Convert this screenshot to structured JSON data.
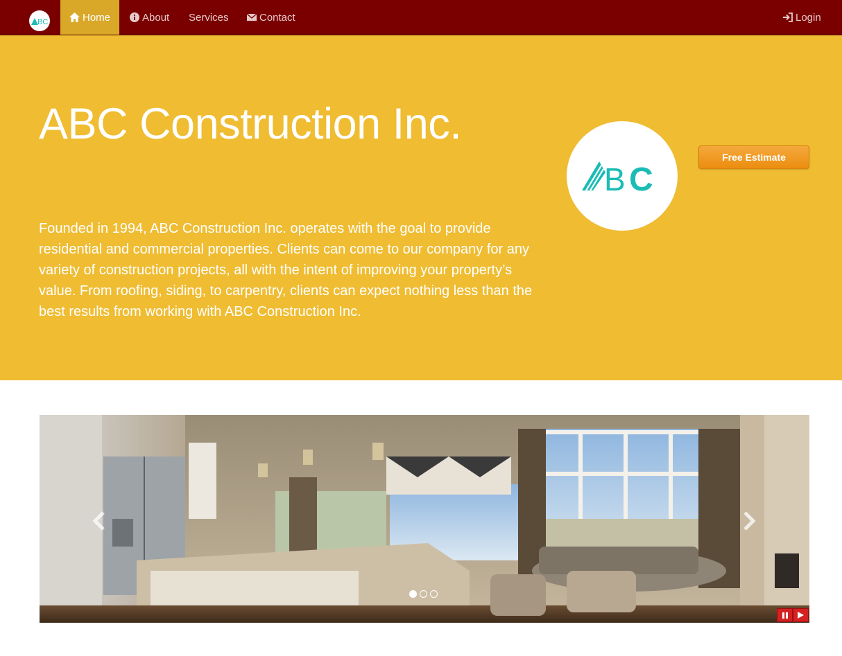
{
  "nav": {
    "brand_icon": "abc-logo-icon",
    "items": [
      {
        "label": "Home",
        "icon": "home-icon",
        "active": true
      },
      {
        "label": "About",
        "icon": "info-icon",
        "active": false
      },
      {
        "label": "Services",
        "icon": "",
        "active": false
      },
      {
        "label": "Contact",
        "icon": "envelope-icon",
        "active": false
      }
    ],
    "login": {
      "label": "Login",
      "icon": "login-icon"
    }
  },
  "hero": {
    "title": "ABC Construction Inc.",
    "description": "Founded in 1994, ABC Construction Inc. operates with the goal to provide residential and commercial properties. Clients can come to our company for any variety of construction projects, all with the intent of improving your property’s value. From roofing, siding, to carpentry, clients can expect nothing less than the best results from working with ABC Construction Inc.",
    "estimate_button": "Free Estimate"
  },
  "carousel": {
    "slide_count": 3,
    "active_index": 0,
    "controls": [
      "pause-icon",
      "play-icon"
    ]
  },
  "colors": {
    "navbar": "#7a0000",
    "nav_active": "#d9a829",
    "hero_bg": "#efbc32",
    "brand_teal": "#1bbcb6",
    "estimate_button": "#ec8d10",
    "player_button": "#d42121"
  }
}
